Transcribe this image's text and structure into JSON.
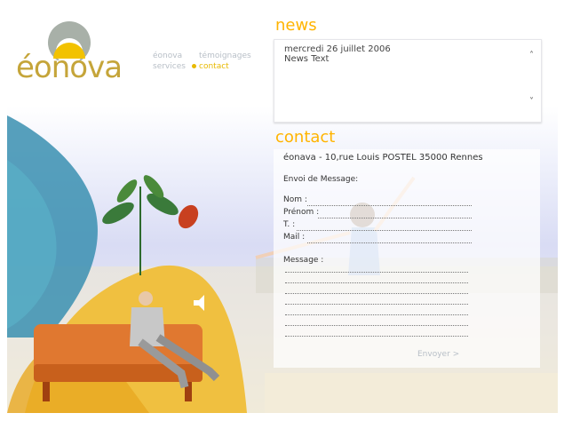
{
  "brand": {
    "logo_text": "éonova"
  },
  "nav": {
    "items": [
      {
        "label": "éonova"
      },
      {
        "label": "témoignages"
      },
      {
        "label": "services"
      },
      {
        "label": "contact"
      }
    ]
  },
  "news": {
    "heading": "news",
    "date": "mercredi 26 juillet 2006",
    "text": "News Text",
    "up_icon": "chevron-up-icon",
    "down_icon": "chevron-down-icon"
  },
  "contact": {
    "heading": "contact",
    "address": "éonava - 10,rue Louis POSTEL 35000 Rennes",
    "envoi_label": "Envoi de Message:",
    "fields": {
      "nom": "Nom :",
      "prenom": "Prénom :",
      "tel": "T. :",
      "mail": "Mail :",
      "message": "Message :"
    },
    "send_label": "Envoyer  >"
  },
  "colors": {
    "accent": "#ffb400",
    "nav_inactive": "#b8bfc7",
    "logo_gold": "#c5a53a",
    "logo_grey": "#a8b0a8"
  }
}
